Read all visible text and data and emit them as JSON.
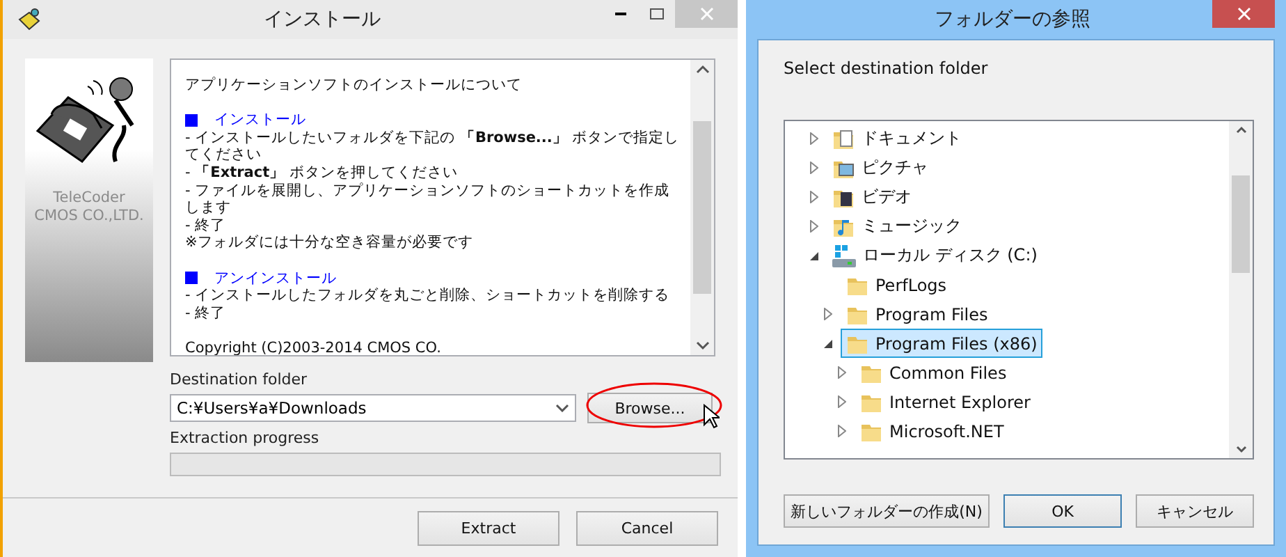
{
  "installer": {
    "title": "インストール",
    "brand": [
      "TeleCoder",
      "CMOS CO.,LTD."
    ],
    "readme": [
      {
        "kind": "text",
        "text": "アプリケーションソフトのインストールについて"
      },
      {
        "kind": "blank"
      },
      {
        "kind": "heading",
        "text": "インストール"
      },
      {
        "kind": "text",
        "text": "- インストールしたいフォルダを下記の **「Browse...」** ボタンで指定してください"
      },
      {
        "kind": "text",
        "text": "- **「Extract」** ボタンを押してください"
      },
      {
        "kind": "text",
        "text": "- ファイルを展開し、アプリケーションソフトのショートカットを作成します"
      },
      {
        "kind": "text",
        "text": "- 終了"
      },
      {
        "kind": "text",
        "text": "※フォルダには十分な空き容量が必要です"
      },
      {
        "kind": "blank"
      },
      {
        "kind": "heading",
        "text": "アンインストール"
      },
      {
        "kind": "text",
        "text": "- インストールしたフォルダを丸ごと削除、ショートカットを削除する"
      },
      {
        "kind": "text",
        "text": "- 終了"
      },
      {
        "kind": "blank"
      },
      {
        "kind": "text",
        "text": "Copyright (C)2003-2014 CMOS CO."
      }
    ],
    "destination_label": "Destination folder",
    "destination_value": "C:¥Users¥a¥Downloads",
    "browse_button": {
      "label": "Browse...",
      "highlighted": true
    },
    "progress_label": "Extraction progress",
    "progress": {
      "level": 0
    },
    "buttons": [
      "Extract",
      "Cancel"
    ]
  },
  "browse_dialog": {
    "title": "フォルダーの参照",
    "prompt": "Select destination folder",
    "tree": [
      {
        "label": "ドキュメント",
        "kind": "documents",
        "has_children": true,
        "expanded": false,
        "selected": false
      },
      {
        "label": "ピクチャ",
        "kind": "pictures",
        "has_children": true,
        "expanded": false,
        "selected": false
      },
      {
        "label": "ビデオ",
        "kind": "videos",
        "has_children": true,
        "expanded": false,
        "selected": false
      },
      {
        "label": "ミュージック",
        "kind": "music",
        "has_children": true,
        "expanded": false,
        "selected": false
      },
      {
        "label": "ローカル ディスク (C:)",
        "kind": "drive",
        "has_children": true,
        "expanded": true,
        "selected": false,
        "children": [
          {
            "label": "PerfLogs",
            "kind": "folder",
            "has_children": false,
            "selected": false
          },
          {
            "label": "Program Files",
            "kind": "folder",
            "has_children": true,
            "expanded": false,
            "selected": false
          },
          {
            "label": "Program Files (x86)",
            "kind": "folder",
            "has_children": true,
            "expanded": true,
            "selected": true,
            "children": [
              {
                "label": "Common Files",
                "kind": "folder",
                "has_children": true,
                "expanded": false,
                "selected": false
              },
              {
                "label": "Internet Explorer",
                "kind": "folder",
                "has_children": true,
                "expanded": false,
                "selected": false
              },
              {
                "label": "Microsoft.NET",
                "kind": "folder",
                "has_children": true,
                "expanded": false,
                "selected": false
              }
            ]
          }
        ]
      }
    ],
    "buttons": [
      {
        "label": "新しいフォルダーの作成(N)",
        "default": false
      },
      {
        "label": "OK",
        "default": true
      },
      {
        "label": "キャンセル",
        "default": false
      }
    ]
  }
}
